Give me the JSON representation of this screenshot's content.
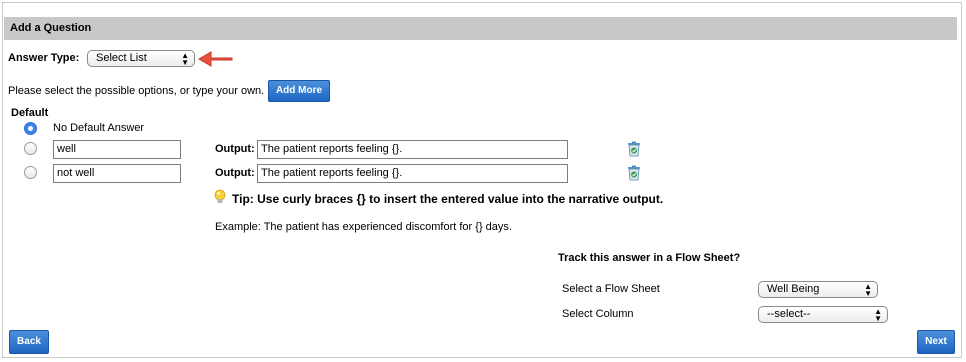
{
  "header": {
    "title": "Add a Question"
  },
  "answer_type": {
    "label": "Answer Type:",
    "selected": "Select List"
  },
  "options": {
    "instruction": "Please select the possible options, or type your own.",
    "add_more_label": "Add More",
    "default_heading": "Default",
    "no_default_label": "No Default Answer",
    "output_label": "Output:",
    "rows": [
      {
        "value": "well",
        "output": "The patient reports feeling {}."
      },
      {
        "value": "not well",
        "output": "The patient reports feeling {}."
      }
    ]
  },
  "tip": {
    "text": "Tip: Use curly braces {} to insert the entered value into the narrative output."
  },
  "example": {
    "text": "Example:  The patient has experienced discomfort for {} days."
  },
  "flow_sheet": {
    "heading": "Track this answer in a Flow Sheet?",
    "sheet_label": "Select a Flow Sheet",
    "sheet_selected": "Well Being",
    "column_label": "Select Column",
    "column_selected": "--select--"
  },
  "nav": {
    "back_label": "Back",
    "next_label": "Next"
  },
  "colors": {
    "accent": "#2a73cc",
    "header_bg": "#c8c8c8",
    "arrow": "#e8503e"
  }
}
